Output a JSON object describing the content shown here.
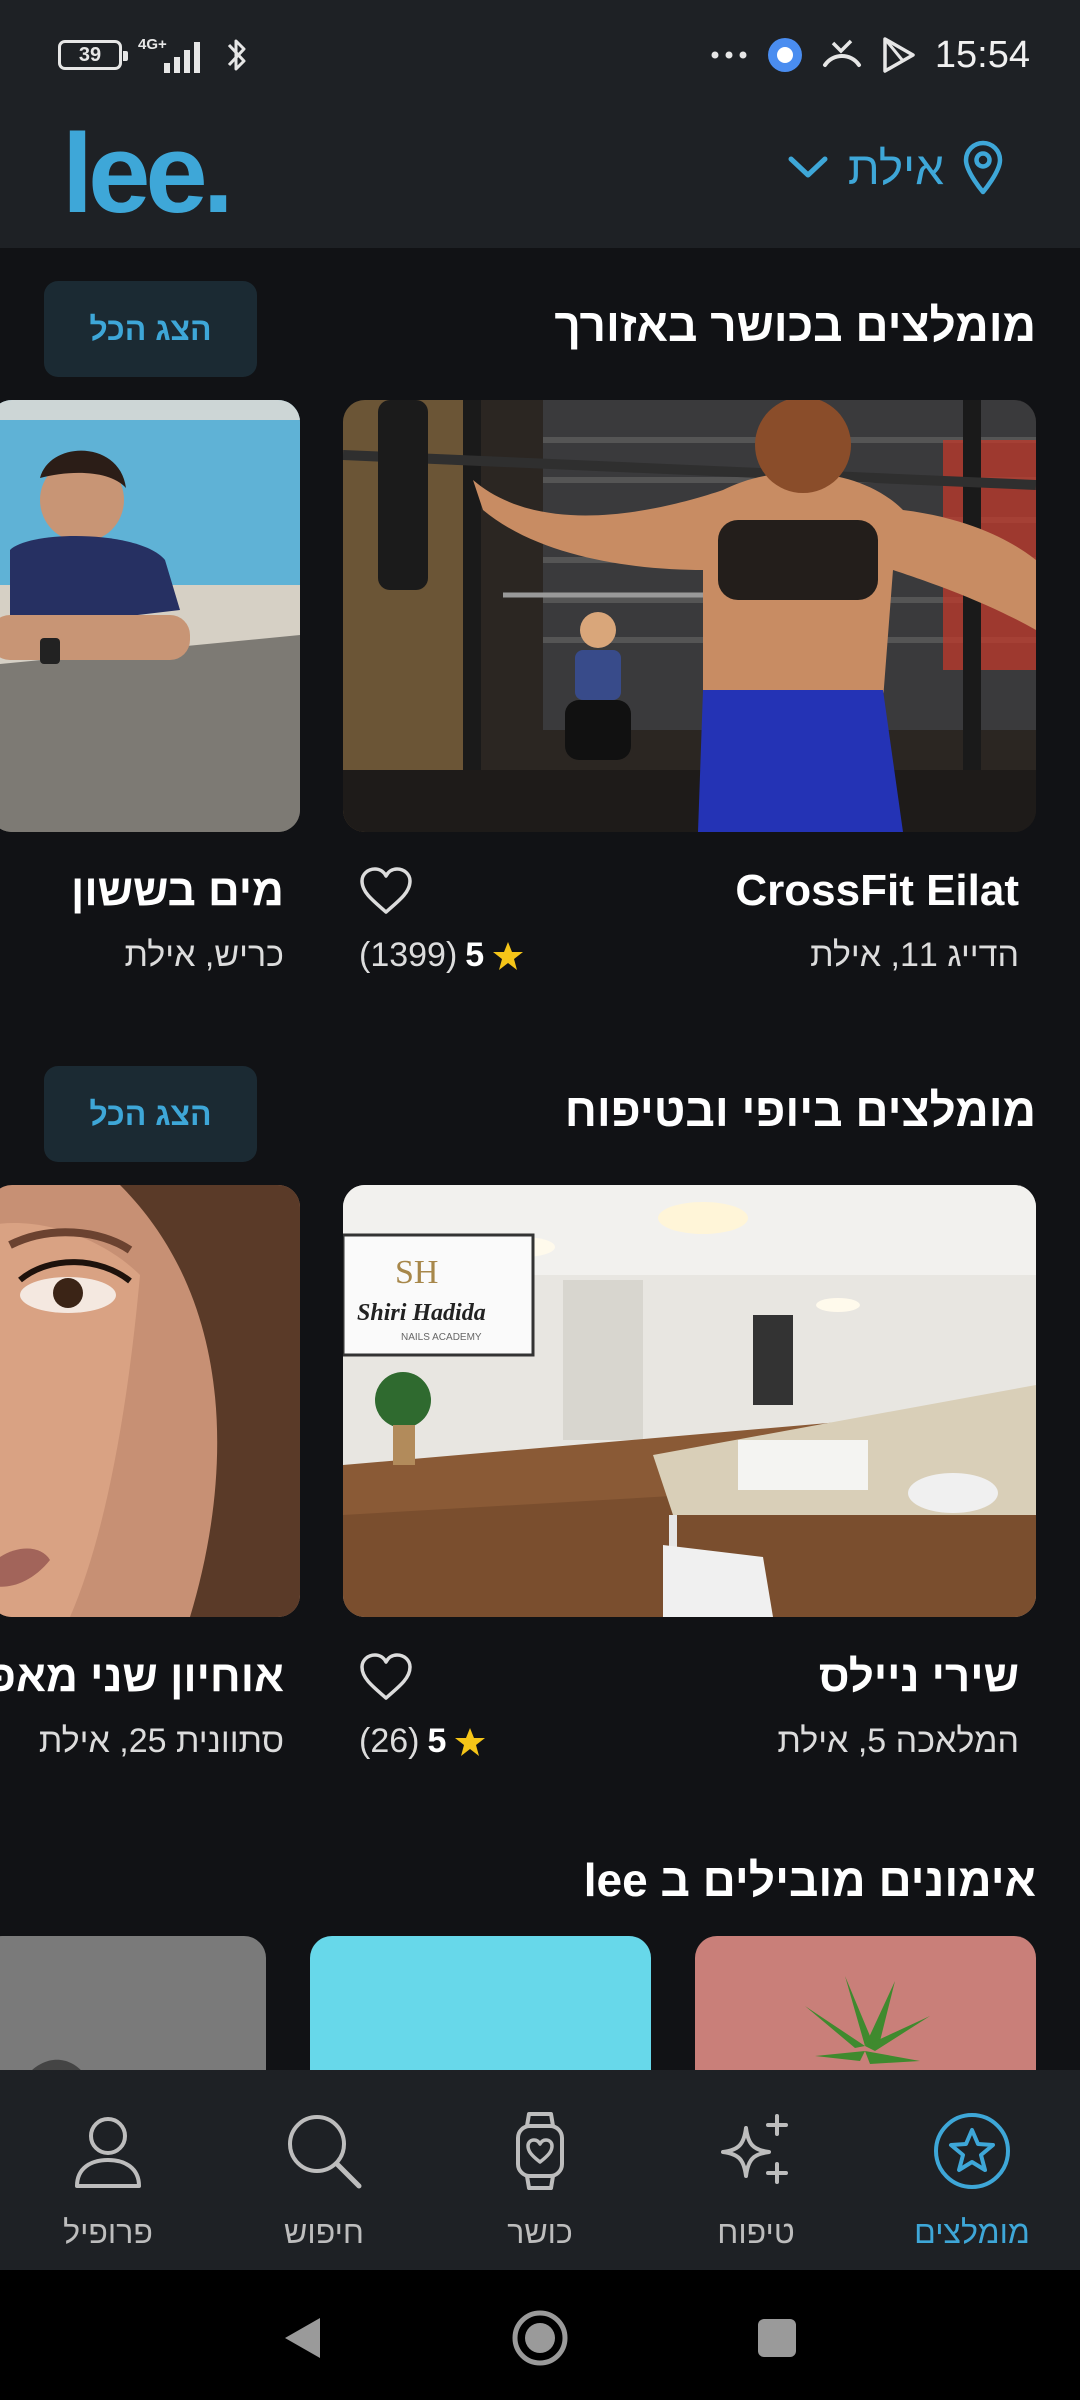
{
  "status_bar": {
    "battery": "39",
    "network": "4G+",
    "time": "15:54"
  },
  "header": {
    "logo": "lee.",
    "location": "אילת"
  },
  "sections": [
    {
      "title": "מומלצים בכושר באזורך",
      "show_all": "הצג הכל",
      "cards": [
        {
          "name": "CrossFit Eilat",
          "address": "הדייג 11, אילת",
          "rating": "5",
          "reviews": "(1399)"
        },
        {
          "name": "מים בששון",
          "address": "כריש, אילת"
        }
      ]
    },
    {
      "title": "מומלצים ביופי ובטיפוח",
      "show_all": "הצג הכל",
      "cards": [
        {
          "name": "שירי ניילס",
          "address": "המלאכה 5, אילת",
          "rating": "5",
          "reviews": "(26)",
          "sign_brand": "Shiri Hadida",
          "sign_sub": "NAILS ACADEMY"
        },
        {
          "name": "אוחיון שני מאפ",
          "address": "סתוונית 25, אילת"
        }
      ]
    },
    {
      "title": "אימונים מובילים ב lee"
    }
  ],
  "bottom_nav": [
    {
      "label": "מומלצים",
      "icon": "star-circle-icon",
      "active": true
    },
    {
      "label": "טיפוח",
      "icon": "sparkles-icon",
      "active": false
    },
    {
      "label": "כושר",
      "icon": "smartwatch-icon",
      "active": false
    },
    {
      "label": "חיפוש",
      "icon": "search-icon",
      "active": false
    },
    {
      "label": "פרופיל",
      "icon": "profile-icon",
      "active": false
    }
  ],
  "colors": {
    "accent": "#3ea7d8",
    "background": "#111215",
    "surface": "#1e2125",
    "star": "#f5c518"
  }
}
